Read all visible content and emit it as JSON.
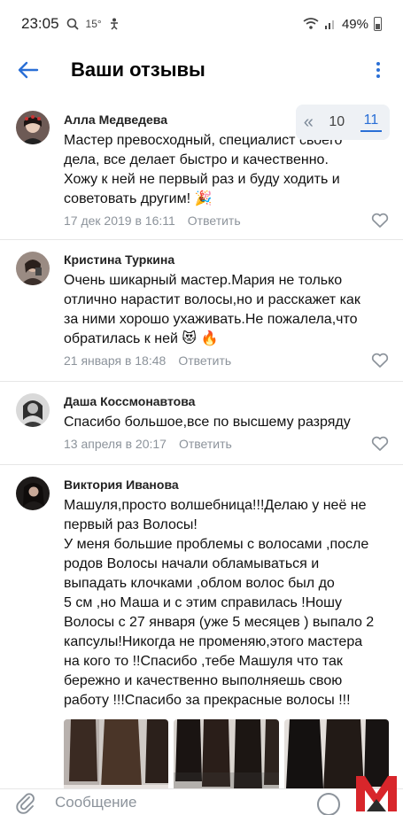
{
  "status_bar": {
    "time": "23:05",
    "temperature": "15°",
    "battery": "49%"
  },
  "header": {
    "title": "Ваши отзывы",
    "back_icon": "arrow-left-icon",
    "menu_icon": "more-vertical-icon"
  },
  "pager": {
    "prev_icon": "double-chevron-left-icon",
    "pages": [
      "10",
      "11"
    ],
    "active_page": "11"
  },
  "reply_label": "Ответить",
  "reviews": [
    {
      "author": "Алла Медведева",
      "text": "Мастер превосходный, специалист своего\nдела, все делает быстро и качественно.\nХожу к ней не первый раз и буду ходить и\nсоветовать другим! 🎉",
      "date": "17 дек 2019 в 16:11"
    },
    {
      "author": "Кристина Туркина",
      "text": "Очень шикарный мастер.Мария не только\nотлично нарастит волосы,но и расскажет как\nза ними хорошо ухаживать.Не пожалела,что\nобратилась к ней 😻 🔥",
      "date": "21 января в 18:48"
    },
    {
      "author": "Даша Коссмонавтова",
      "text": "Спасибо большое,все по высшему разряду",
      "date": "13 апреля в 20:17"
    },
    {
      "author": "Виктория Иванова",
      "text": "Машуля,просто волшебница!!!Делаю у неё не\nпервый раз Волосы!\nУ меня большие проблемы с волосами ,после\nродов Волосы начали обламываться и\nвыпадать клочками ,облом волос был до\n5 см ,но Маша и с этим справилась !Ношу\nВолосы с 27 января (уже 5 месяцев ) выпало 2\nкапсулы!Никогда не променяю,этого мастера\nна кого то !!Спасибо ,тебе Машуля что так\nбережно и качественно выполняешь свою\nработу !!!Спасибо за прекрасные волосы !!!",
      "date": ""
    }
  ],
  "input": {
    "placeholder": "Сообщение"
  },
  "colors": {
    "accent": "#2a6fd6",
    "meta": "#8c939b",
    "logo_red": "#d8262b"
  }
}
